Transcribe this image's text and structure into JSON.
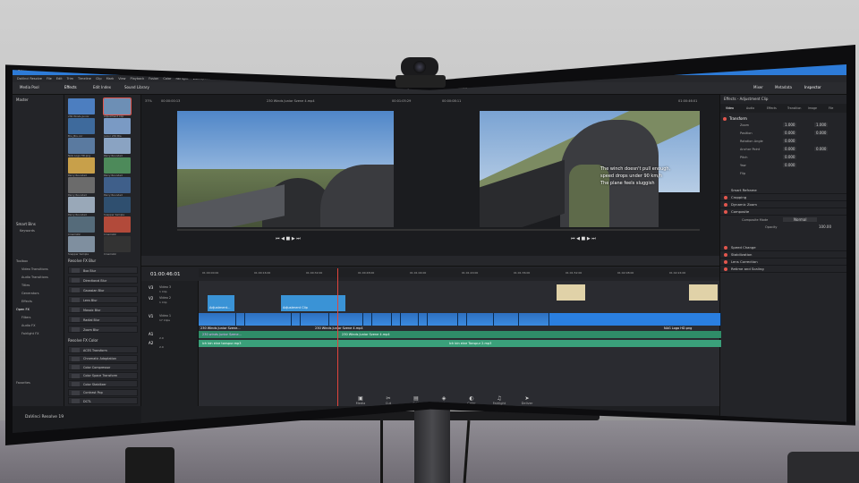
{
  "app": {
    "window_title": "DaVinci Resolve Studio - Junior Winds 230 Meter",
    "menu": [
      "DaVinci Resolve",
      "File",
      "Edit",
      "Trim",
      "Timeline",
      "Clip",
      "Mark",
      "View",
      "Playback",
      "Fusion",
      "Color",
      "Fairlight",
      "Workspace",
      "Help"
    ],
    "brand": "DaVinci Resolve 19"
  },
  "toolbar": {
    "media_pool": "Media Pool",
    "effects": "Effects",
    "edit_index": "Edit Index",
    "sound_library": "Sound Library",
    "mixer": "Mixer",
    "metadata": "Metadata",
    "inspector": "Inspector",
    "project_title": "Junior Winds 230 Meter",
    "edited": "Edited"
  },
  "media_pool": {
    "header": "Master",
    "smart_bins": "Smart Bins",
    "keywords": "Keywords",
    "favorites": "Favorites",
    "clips": [
      "230 Winds Junior",
      "Adjustment Clip",
      "Bru_Bru.cor",
      "Junior 230 Bla",
      "NAG Logo HD.png",
      "Percy Rounded",
      "Percy Rounded",
      "Percy Rounded",
      "Percy Rounded",
      "Percy Rounded",
      "Percy Rounded",
      "Snapper Sample",
      "Cinematic",
      "Cinematic",
      "Snapper Sample",
      "Cinematic"
    ]
  },
  "effects": {
    "tree": [
      "Toolbox",
      "Video Transitions",
      "Audio Transitions",
      "Titles",
      "Generators",
      "Effects",
      "Open FX",
      "Filters",
      "Audio FX",
      "Fairlight FX"
    ],
    "group_blur": "Resolve FX Blur",
    "blur_items": [
      "Box Blur",
      "Directional Blur",
      "Gaussian Blur",
      "Lens Blur",
      "Mosaic Blur",
      "Radial Blur",
      "Zoom Blur"
    ],
    "group_color": "Resolve FX Color",
    "color_items": [
      "ACES Transform",
      "Chromatic Adaptation",
      "Color Compressor",
      "Color Space Transform",
      "Color Stabilizer",
      "Contrast Pop",
      "DCTL"
    ]
  },
  "source_viewer": {
    "zoom": "37%",
    "timecode": "00:00:00:13",
    "clip_name": "230 Winds Junior Szene 4.mp4",
    "duration": "00:01:05:29"
  },
  "timeline_viewer": {
    "zoom": "37%",
    "timecode_top": "00:00:08:11",
    "timecode_right": "01:00:46:01",
    "subtitle_line1": "The winch doesn't pull enough,",
    "subtitle_line2": "speed drops under 90 km/h",
    "subtitle_line3": "The plane feels sluggish"
  },
  "timeline": {
    "timecode": "01:00:46:01",
    "ruler": [
      "01:00:00:00",
      "01:00:16:00",
      "01:00:32:00",
      "01:00:48:00",
      "01:01:04:00",
      "01:01:20:00",
      "01:01:36:00",
      "01:01:52:00",
      "01:02:08:00",
      "01:02:24:00"
    ],
    "tracks": [
      {
        "id": "V3",
        "name": "Video 3",
        "clips": "1 Clip"
      },
      {
        "id": "V2",
        "name": "Video 2",
        "clips": "1 Clip"
      },
      {
        "id": "V1",
        "name": "Video 1",
        "clips": "17 Clips"
      },
      {
        "id": "A1",
        "name": "",
        "clips": "2.0"
      },
      {
        "id": "A2",
        "name": "",
        "clips": "2.0"
      }
    ],
    "clip_labels": [
      "Adjustment...",
      "Adjustment Clip",
      "230 Winds Junior Szene...",
      "230 Winds Junior Szene 4.mp4",
      "NAG Logo HD.png"
    ],
    "audio_labels": [
      "230 winds junior Szene...",
      "230 Winds Junior Szene 4.mp4",
      "Ich bin eine Tonspur 2.mp3",
      "ich bin eine tonspur.mp3"
    ]
  },
  "pages": [
    "Media",
    "Cut",
    "Edit",
    "Fusion",
    "Color",
    "Fairlight",
    "Deliver"
  ],
  "inspector": {
    "title": "Effects - Adjustment Clip",
    "tabs": [
      "Video",
      "Audio",
      "Effects",
      "Transition",
      "Image",
      "File"
    ],
    "transform": "Transform",
    "rows": [
      {
        "label": "Zoom",
        "x": "1.000",
        "y": "1.000"
      },
      {
        "label": "Position",
        "x": "0.000",
        "y": "0.000"
      },
      {
        "label": "Rotation Angle",
        "x": "0.000",
        "y": ""
      },
      {
        "label": "Anchor Point",
        "x": "0.000",
        "y": "0.000"
      },
      {
        "label": "Pitch",
        "x": "0.000",
        "y": ""
      },
      {
        "label": "Yaw",
        "x": "0.000",
        "y": ""
      },
      {
        "label": "Flip",
        "x": "",
        "y": ""
      }
    ],
    "sections": [
      "Smart Reframe",
      "Cropping",
      "Dynamic Zoom",
      "Composite",
      "Speed Change",
      "Stabilization",
      "Lens Correction",
      "Retime and Scaling"
    ],
    "composite_mode_label": "Composite Mode",
    "composite_mode": "Normal",
    "opacity_label": "Opacity",
    "opacity": "100.00"
  }
}
